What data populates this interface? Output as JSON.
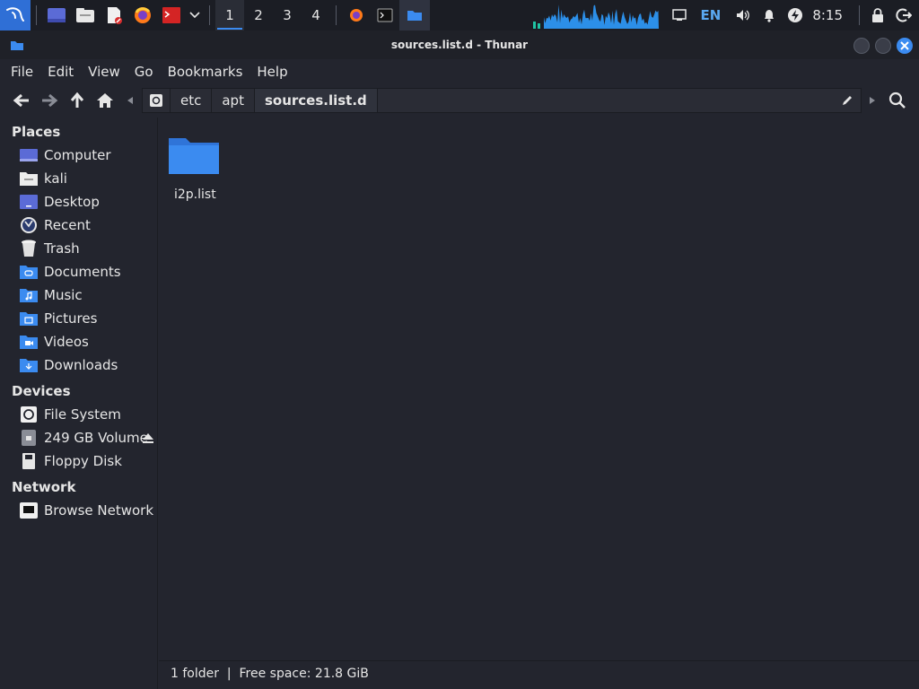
{
  "taskbar": {
    "workspaces": [
      "1",
      "2",
      "3",
      "4"
    ],
    "active_workspace": "1",
    "keyboard_layout": "EN",
    "clock": "8:15",
    "accent": "#2f6fd6"
  },
  "window": {
    "title": "sources.list.d - Thunar"
  },
  "menubar": {
    "items": [
      "File",
      "Edit",
      "View",
      "Go",
      "Bookmarks",
      "Help"
    ]
  },
  "pathbar": {
    "crumbs": [
      "etc",
      "apt",
      "sources.list.d"
    ]
  },
  "sidebar": {
    "places_title": "Places",
    "places": [
      {
        "label": "Computer",
        "icon": "computer-icon"
      },
      {
        "label": "kali",
        "icon": "home-folder-icon"
      },
      {
        "label": "Desktop",
        "icon": "desktop-icon"
      },
      {
        "label": "Recent",
        "icon": "recent-icon"
      },
      {
        "label": "Trash",
        "icon": "trash-icon"
      },
      {
        "label": "Documents",
        "icon": "documents-folder-icon"
      },
      {
        "label": "Music",
        "icon": "music-folder-icon"
      },
      {
        "label": "Pictures",
        "icon": "pictures-folder-icon"
      },
      {
        "label": "Videos",
        "icon": "videos-folder-icon"
      },
      {
        "label": "Downloads",
        "icon": "downloads-folder-icon"
      }
    ],
    "devices_title": "Devices",
    "devices": [
      {
        "label": "File System",
        "icon": "drive-icon"
      },
      {
        "label": "249 GB Volume",
        "icon": "volume-icon"
      },
      {
        "label": "Floppy Disk",
        "icon": "floppy-icon"
      }
    ],
    "network_title": "Network",
    "network": [
      {
        "label": "Browse Network",
        "icon": "network-icon"
      }
    ]
  },
  "files": [
    {
      "name": "i2p.list",
      "icon": "folder-icon"
    }
  ],
  "status": {
    "text": "1 folder  |  Free space: 21.8 GiB"
  }
}
